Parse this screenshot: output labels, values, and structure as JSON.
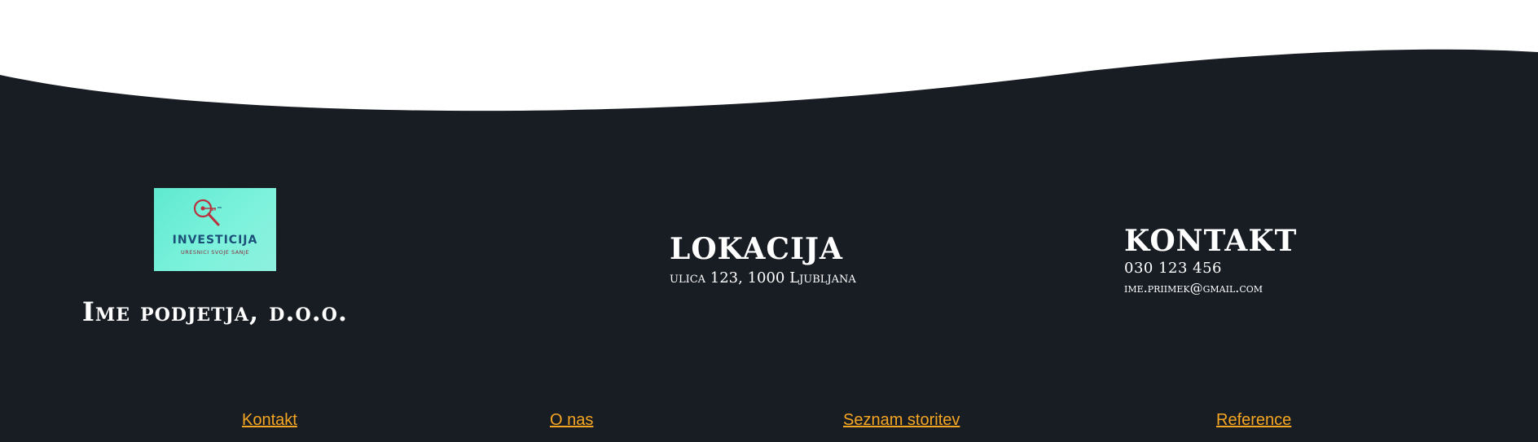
{
  "colors": {
    "background_top": "#ffffff",
    "footer_background": "#181c23",
    "heading_text": "#ffffff",
    "link": "#f5a623",
    "logo_background": "#6eecd6"
  },
  "logo": {
    "icon": "magnifier-key-icon",
    "title": "INVESTICIJA",
    "tagline": "URESNICI SVOJE SANJE"
  },
  "company": {
    "name": "Ime podjetja, d.o.o."
  },
  "location": {
    "heading": "LOKACIJA",
    "address": "ulica 123, 1000 Ljubljana"
  },
  "contact": {
    "heading": "KONTAKT",
    "phone": "030 123 456",
    "email": "ime.priimek@gmail.com"
  },
  "nav": {
    "links": [
      {
        "label": "Kontakt"
      },
      {
        "label": "O nas"
      },
      {
        "label": "Seznam storitev"
      },
      {
        "label": "Reference"
      }
    ]
  }
}
